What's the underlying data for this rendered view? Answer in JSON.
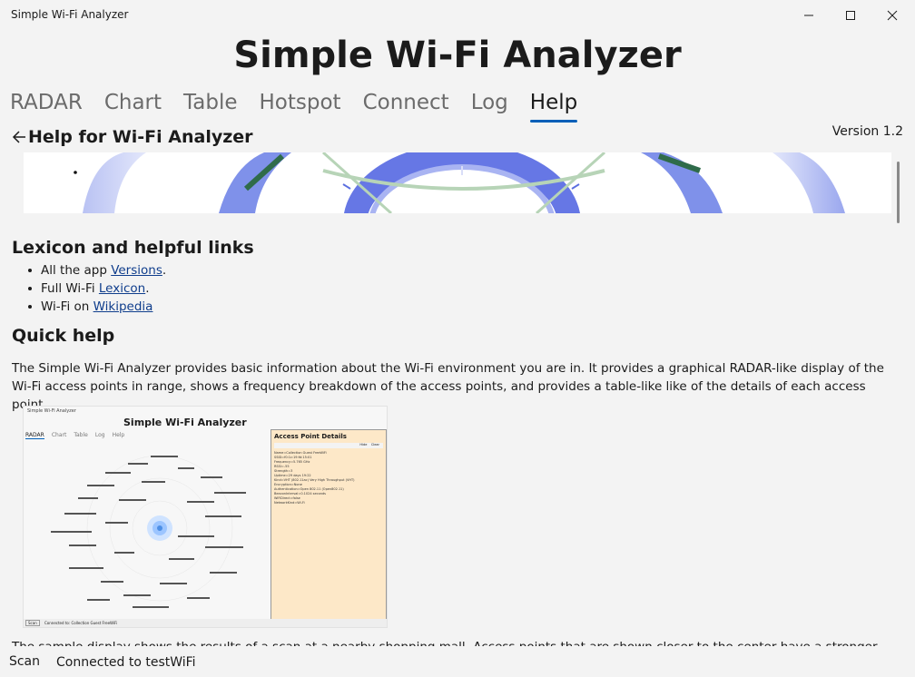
{
  "window": {
    "title": "Simple Wi-Fi Analyzer"
  },
  "app": {
    "heading": "Simple Wi-Fi Analyzer"
  },
  "tabs": [
    {
      "label": "RADAR"
    },
    {
      "label": "Chart"
    },
    {
      "label": "Table"
    },
    {
      "label": "Hotspot"
    },
    {
      "label": "Connect"
    },
    {
      "label": "Log"
    },
    {
      "label": "Help",
      "active": true
    }
  ],
  "help": {
    "title": "Help for Wi-Fi Analyzer",
    "version": "Version 1.2",
    "lexicon_heading": "Lexicon and helpful links",
    "links": [
      {
        "prefix": "All the app ",
        "link": "Versions",
        "suffix": "."
      },
      {
        "prefix": "Full Wi-Fi ",
        "link": "Lexicon",
        "suffix": "."
      },
      {
        "prefix": "Wi-Fi on ",
        "link": "Wikipedia",
        "suffix": ""
      }
    ],
    "quick_heading": "Quick help",
    "intro": "The Simple Wi-Fi Analyzer provides basic information about the Wi-Fi environment you are in. It provides a graphical RADAR-like display of the Wi-Fi access points in range, shows a frequency breakdown of the access points, and provides a table-like like of the details of each access point.",
    "sample": "The sample display shows the results of a scan at a nearby shopping mall. Access points that are shown closer to the center have a stronger signal; ones further"
  },
  "sample_image": {
    "window_title": "Simple Wi-Fi Analyzer",
    "heading": "Simple Wi-Fi Analyzer",
    "tabs": [
      "RADAR",
      "Chart",
      "Table",
      "Log",
      "Help"
    ],
    "panel_title": "Access Point Details",
    "panel_buttons": [
      "Hide",
      "Clear"
    ],
    "panel_lines": [
      "Name=Collection Guest FreeWiFi",
      "SSID=f0:1c:19:fd:15:01",
      "Frequency=5.765 GHz",
      "RSSI=-55",
      "Strength=3",
      "Uptime=29 days 19:22",
      "Kind=VHT (802.11ac) Very High Throughput (VHT)",
      "Encryption=None",
      "Authentication=Open 802.11 (Open802.11)",
      "BeaconInterval=0.1024 seconds",
      "WiFiDirect=false",
      "NetworkKind=Wi-Fi"
    ],
    "status_button": "Scan",
    "status_text": "Connected to: Collection Guest FreeWiFi"
  },
  "status": {
    "scan_label": "Scan",
    "connection_text": "Connected to testWiFi"
  },
  "colors": {
    "accent": "#005fb8",
    "link": "#0f3d8c",
    "radar_blue": "#4a63e0",
    "radar_green": "#8fbf8f",
    "panel_bg": "#fde8c8"
  },
  "icons": [
    "minimize-icon",
    "maximize-icon",
    "close-icon",
    "back-arrow-icon"
  ]
}
